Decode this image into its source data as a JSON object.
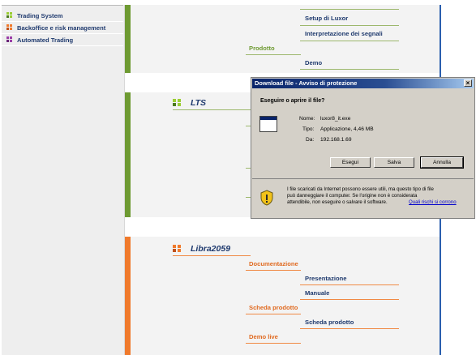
{
  "sidebar": {
    "items": [
      {
        "label": "Trading System",
        "colors": [
          "#9acd32",
          "#4a7a1e"
        ]
      },
      {
        "label": "Backoffice e risk management",
        "colors": [
          "#f07a2c",
          "#c0501a"
        ]
      },
      {
        "label": "Automated Trading",
        "colors": [
          "#9b3fa8",
          "#6a2578"
        ]
      }
    ]
  },
  "luxor": {
    "links": [
      "Setup di Luxor",
      "Interpretazione dei segnali"
    ],
    "category": "Prodotto",
    "demo": "Demo"
  },
  "lts": {
    "title": "LTS"
  },
  "libra": {
    "title": "Libra2059",
    "categories": [
      "Documentazione",
      "Scheda prodotto",
      "Demo live"
    ],
    "links": [
      "Presentazione",
      "Manuale",
      "Scheda prodotto"
    ]
  },
  "dialog": {
    "title": "Download file - Avviso di protezione",
    "question": "Eseguire o aprire il file?",
    "name_label": "Nome:",
    "name_value": "luxor8_it.exe",
    "type_label": "Tipo:",
    "type_value": "Applicazione, 4,46 MB",
    "from_label": "Da:",
    "from_value": "192.168.1.69",
    "buttons": {
      "run": "Esegui",
      "save": "Salva",
      "cancel": "Annulla"
    },
    "warning_line1": "I file scaricati da Internet possono essere utili, ma questo tipo di file",
    "warning_line2": "può danneggiare il computer. Se l'origine non è considerata",
    "warning_line3": "attendibile, non eseguire o salvare il software.",
    "risk_link": "Quali rischi si corrono"
  },
  "colors": {
    "green": "#6e9a32",
    "orange": "#f07a2c",
    "link_blue": "#1f3a6e",
    "title_bar": "#0a246a"
  }
}
